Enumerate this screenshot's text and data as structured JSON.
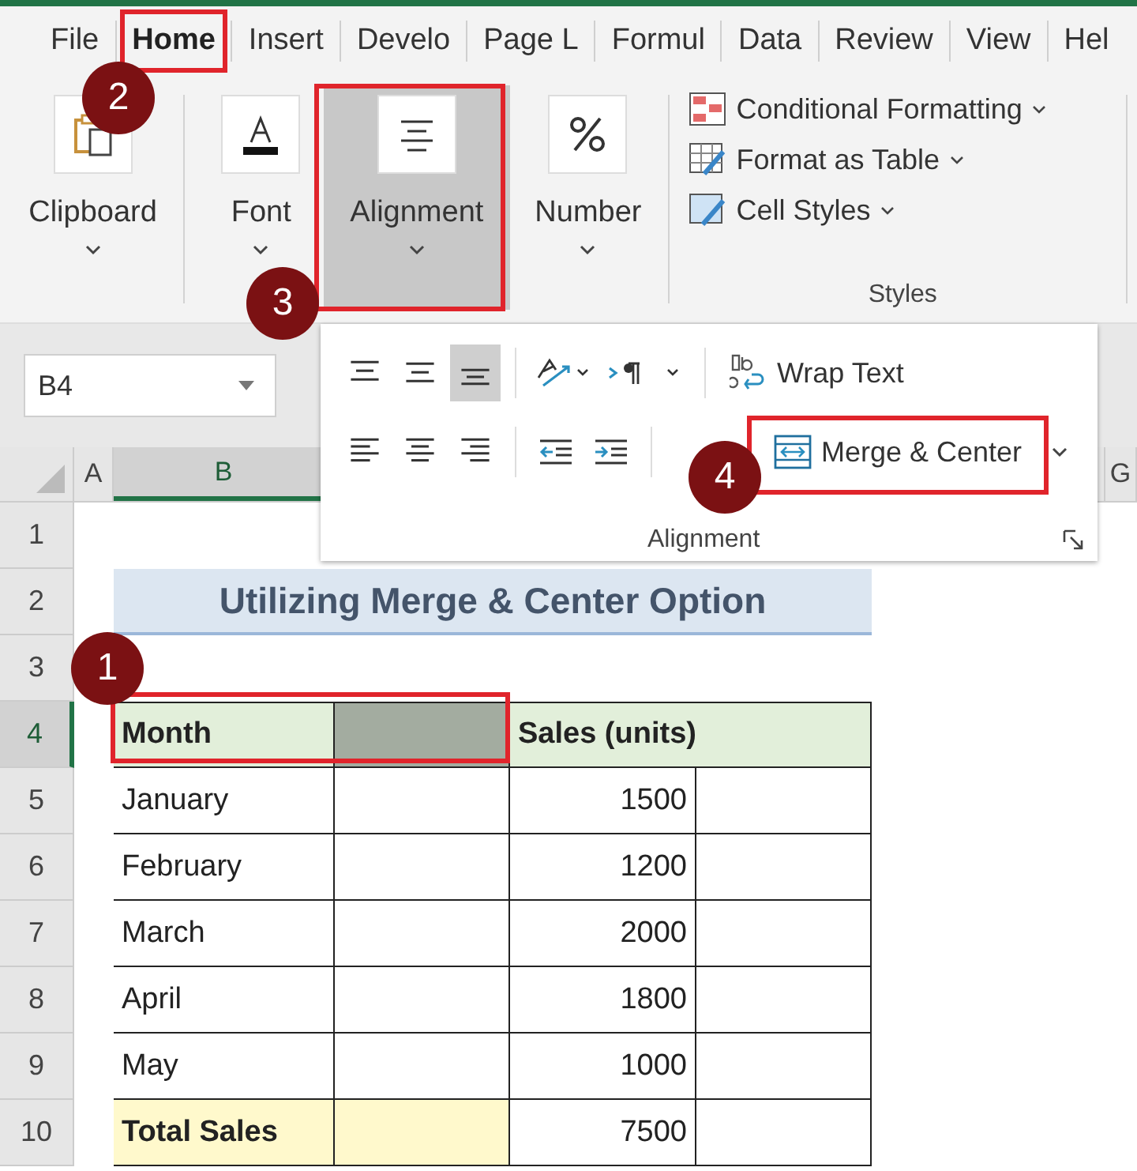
{
  "tabs": [
    {
      "label": "File",
      "selected": false
    },
    {
      "label": "Home",
      "selected": true
    },
    {
      "label": "Insert",
      "selected": false
    },
    {
      "label": "Develo",
      "selected": false
    },
    {
      "label": "Page L",
      "selected": false
    },
    {
      "label": "Formul",
      "selected": false
    },
    {
      "label": "Data",
      "selected": false
    },
    {
      "label": "Review",
      "selected": false
    },
    {
      "label": "View",
      "selected": false
    },
    {
      "label": "Hel",
      "selected": false
    }
  ],
  "ribbon_groups": [
    {
      "kind": "clipboard",
      "label": "Clipboard",
      "selected": false
    },
    {
      "kind": "font",
      "label": "Font",
      "selected": false
    },
    {
      "kind": "alignment",
      "label": "Alignment",
      "selected": true
    },
    {
      "kind": "number",
      "label": "Number",
      "selected": false
    }
  ],
  "styles_group": {
    "label": "Styles",
    "items": [
      {
        "kind": "conditional",
        "label": "Conditional Formatting"
      },
      {
        "kind": "table",
        "label": "Format as Table"
      },
      {
        "kind": "cell",
        "label": "Cell Styles"
      }
    ]
  },
  "name_box": {
    "value": "B4"
  },
  "alignment_panel": {
    "label": "Alignment",
    "rows": [
      [
        {
          "kind": "vtop",
          "selected": false
        },
        {
          "kind": "vmiddle",
          "selected": false
        },
        {
          "kind": "vbottom",
          "selected": true
        },
        {
          "kind": "orientation",
          "selected": false
        },
        {
          "kind": "direction",
          "selected": false
        },
        {
          "kind": "wrap",
          "label": "Wrap Text",
          "selected": false
        }
      ],
      [
        {
          "kind": "left",
          "selected": false
        },
        {
          "kind": "center",
          "selected": false
        },
        {
          "kind": "right",
          "selected": false
        },
        {
          "kind": "outdent",
          "selected": false
        },
        {
          "kind": "indent",
          "selected": false
        },
        {
          "kind": "merge",
          "label": "Merge & Center",
          "selected": false
        }
      ]
    ]
  },
  "column_headers": [
    {
      "label": "A",
      "selected": false
    },
    {
      "label": "B",
      "selected": true
    },
    {
      "label": "G",
      "selected": false
    }
  ],
  "row_numbers": [
    {
      "label": "1",
      "selected": false
    },
    {
      "label": "2",
      "selected": false
    },
    {
      "label": "3",
      "selected": false
    },
    {
      "label": "4",
      "selected": true
    },
    {
      "label": "5",
      "selected": false
    },
    {
      "label": "6",
      "selected": false
    },
    {
      "label": "7",
      "selected": false
    },
    {
      "label": "8",
      "selected": false
    },
    {
      "label": "9",
      "selected": false
    },
    {
      "label": "10",
      "selected": false
    }
  ],
  "title": "Utilizing Merge & Center Option",
  "table": {
    "header": {
      "month": "Month",
      "sales": "Sales (units)",
      "blank_selected": true
    },
    "rows": [
      {
        "month": "January",
        "sales": "1500"
      },
      {
        "month": "February",
        "sales": "1200"
      },
      {
        "month": "March",
        "sales": "2000"
      },
      {
        "month": "April",
        "sales": "1800"
      },
      {
        "month": "May",
        "sales": "1000"
      }
    ],
    "total": {
      "label": "Total Sales",
      "value": "7500"
    }
  },
  "callouts": [
    {
      "number": "1"
    },
    {
      "number": "2"
    },
    {
      "number": "3"
    },
    {
      "number": "4"
    }
  ]
}
